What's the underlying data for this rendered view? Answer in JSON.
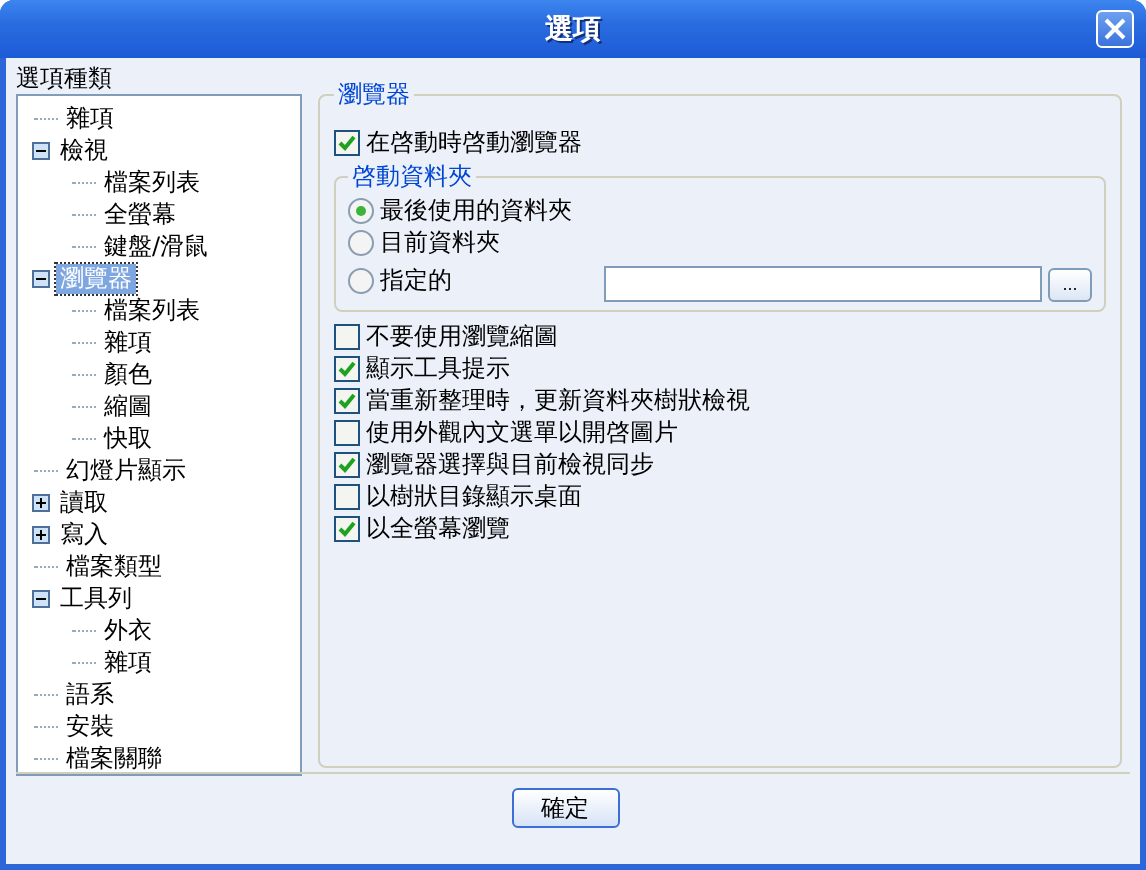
{
  "window": {
    "title": "選項"
  },
  "sidebar": {
    "label": "選項種類",
    "tree": [
      {
        "label": "雜項",
        "selected": false
      },
      {
        "label": "檢視",
        "selected": false,
        "expanded": true,
        "children": [
          {
            "label": "檔案列表",
            "selected": false
          },
          {
            "label": "全螢幕",
            "selected": false
          },
          {
            "label": "鍵盤/滑鼠",
            "selected": false
          }
        ]
      },
      {
        "label": "瀏覽器",
        "selected": true,
        "expanded": true,
        "children": [
          {
            "label": "檔案列表",
            "selected": false
          },
          {
            "label": "雜項",
            "selected": false
          },
          {
            "label": "顏色",
            "selected": false
          },
          {
            "label": "縮圖",
            "selected": false
          },
          {
            "label": "快取",
            "selected": false
          }
        ]
      },
      {
        "label": "幻燈片顯示",
        "selected": false
      },
      {
        "label": "讀取",
        "selected": false,
        "expanded": false
      },
      {
        "label": "寫入",
        "selected": false,
        "expanded": false
      },
      {
        "label": "檔案類型",
        "selected": false
      },
      {
        "label": "工具列",
        "selected": false,
        "expanded": true,
        "children": [
          {
            "label": "外衣",
            "selected": false
          },
          {
            "label": "雜項",
            "selected": false
          }
        ]
      },
      {
        "label": "語系",
        "selected": false
      },
      {
        "label": "安裝",
        "selected": false
      },
      {
        "label": "檔案關聯",
        "selected": false
      }
    ]
  },
  "panel": {
    "title": "瀏覽器",
    "start_option": {
      "label": "在啓動時啓動瀏覽器",
      "checked": true
    },
    "start_folder": {
      "title": "啓動資料夾",
      "options": [
        {
          "label": "最後使用的資料夾",
          "selected": true
        },
        {
          "label": "目前資料夾",
          "selected": false
        },
        {
          "label": "指定的",
          "selected": false
        }
      ],
      "browse_button": "..."
    },
    "options": [
      {
        "label": "不要使用瀏覽縮圖",
        "checked": false
      },
      {
        "label": "顯示工具提示",
        "checked": true
      },
      {
        "label": "當重新整理時，更新資料夾樹狀檢視",
        "checked": true
      },
      {
        "label": "使用外觀內文選單以開啓圖片",
        "checked": false
      },
      {
        "label": "瀏覽器選擇與目前檢視同步",
        "checked": true
      },
      {
        "label": "以樹狀目錄顯示桌面",
        "checked": false
      },
      {
        "label": "以全螢幕瀏覽",
        "checked": true
      }
    ]
  },
  "buttons": [
    "確定"
  ]
}
